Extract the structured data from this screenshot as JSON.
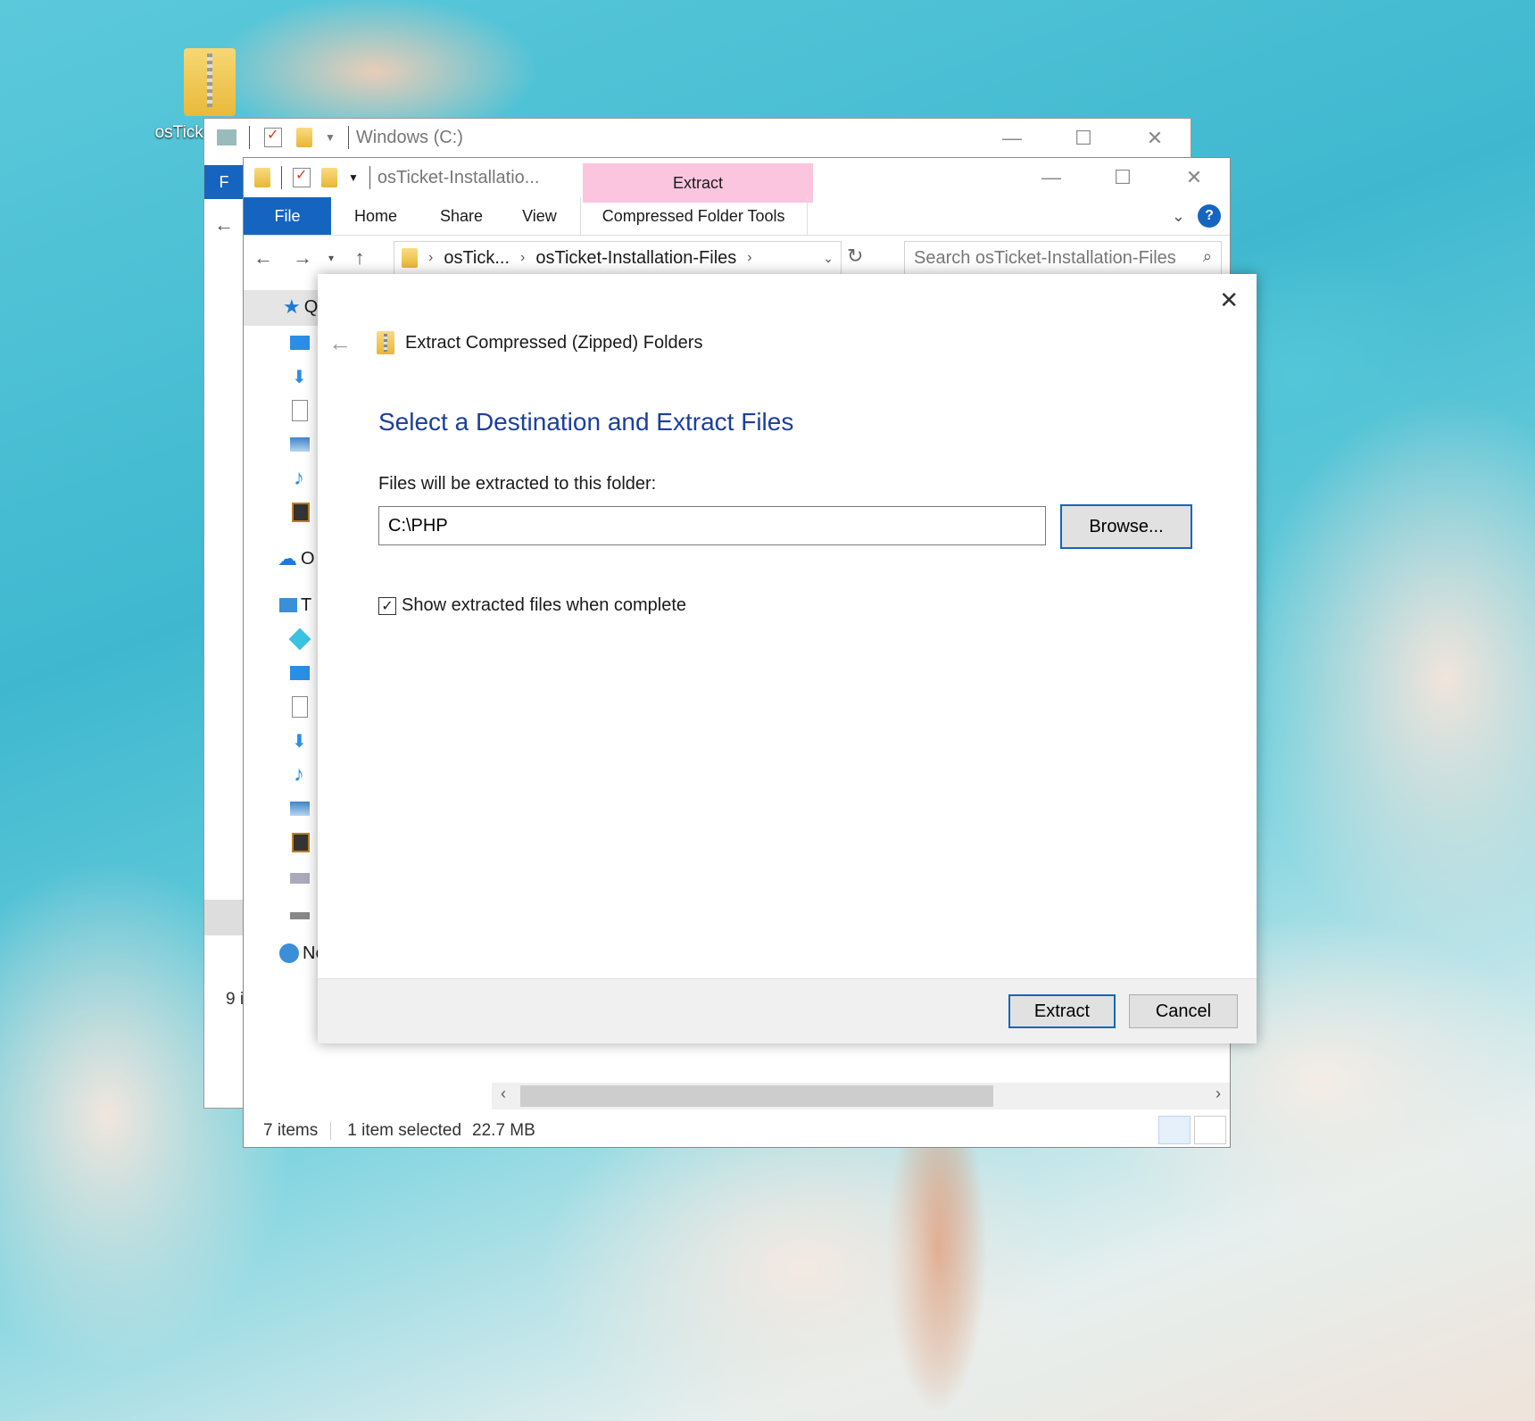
{
  "desktop": {
    "icon_label": "osTicke"
  },
  "back_window": {
    "title": "Windows (C:)",
    "file_tab_partial": "F",
    "status_partial": "9 i"
  },
  "explorer": {
    "title": "osTicket-Installatio...",
    "contextual_tab": "Extract",
    "tabs": {
      "file": "File",
      "home": "Home",
      "share": "Share",
      "view": "View",
      "tools": "Compressed Folder Tools"
    },
    "window_buttons": {
      "minimize": "—",
      "maximize": "☐",
      "close": "✕"
    },
    "breadcrumb": [
      "osTick...",
      "osTicket-Installation-Files"
    ],
    "search_placeholder": "Search osTicket-Installation-Files",
    "nav": {
      "quick_access_partial": "Q",
      "onedrive_partial": "O",
      "this_pc_partial": "T",
      "network": "Network"
    },
    "status": {
      "items": "7 items",
      "selected": "1 item selected",
      "size": "22.7 MB"
    },
    "accent_color": "#1565c0",
    "contextual_color": "#fbc5df"
  },
  "dialog": {
    "header": "Extract Compressed (Zipped) Folders",
    "title": "Select a Destination and Extract Files",
    "folder_label": "Files will be extracted to this folder:",
    "path_value": "C:\\PHP",
    "browse_label": "Browse...",
    "checkbox_label": "Show extracted files when complete",
    "checkbox_checked": true,
    "extract_label": "Extract",
    "cancel_label": "Cancel",
    "title_color": "#1b3f9c"
  }
}
